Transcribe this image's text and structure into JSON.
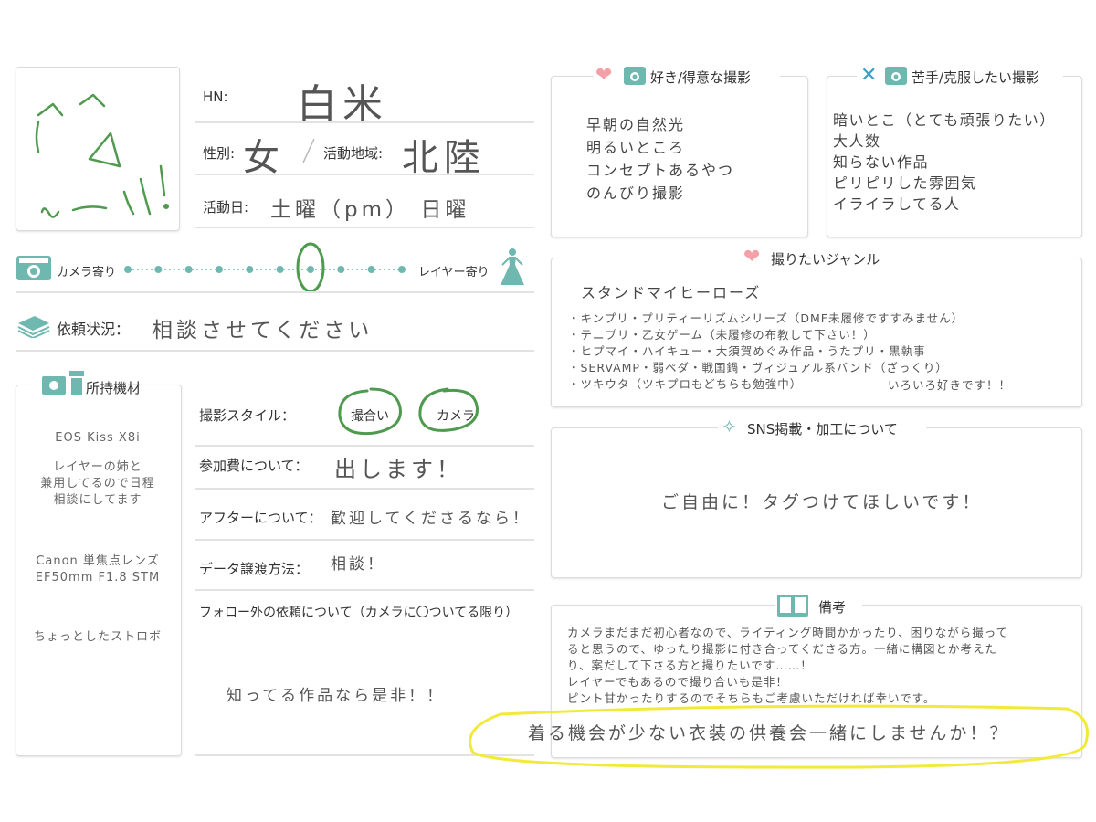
{
  "profile": {
    "hn_label": "HN:",
    "hn_value": "白米",
    "gender_label": "性別:",
    "gender_value": "女",
    "area_label": "活動地域:",
    "area_value": "北陸",
    "days_label": "活動日:",
    "days_value": "土曜（pm） 日曜",
    "avatar_scribble": "わーい！"
  },
  "scale": {
    "left_label": "カメラ寄り",
    "right_label": "レイヤー寄り",
    "dot_count": 10,
    "selected_index": 6
  },
  "request": {
    "label": "依頼状況：",
    "value": "相談させてください"
  },
  "gear": {
    "title": "所持機材",
    "items": [
      "EOS Kiss X8i",
      "レイヤーの姉と",
      "兼用してるので日程",
      "相談にしてます",
      "Canon 単焦点レンズ",
      "EF50mm F1.8 STM",
      "ちょっとしたストロボ"
    ]
  },
  "details": {
    "style_label": "撮影スタイル：",
    "style_options": [
      "撮合い",
      "カメラ"
    ],
    "fee_label": "参加費について：",
    "fee_value": "出します！",
    "after_label": "アフターについて：",
    "after_value": "歓迎してくださるなら！",
    "data_label": "データ譲渡方法：",
    "data_value": "相談！",
    "follow_label": "フォロー外の依頼について（カメラに〇ついてる限り）",
    "follow_value": "知ってる作品なら是非！！"
  },
  "likes": {
    "title": "好き/得意な撮影",
    "items": [
      "早朝の自然光",
      "明るいところ",
      "コンセプトあるやつ",
      "のんびり撮影"
    ]
  },
  "dislikes": {
    "title": "苦手/克服したい撮影",
    "items": [
      "暗いとこ（とても頑張りたい）",
      "大人数",
      "知らない作品",
      "ピリピリした雰囲気",
      "イライラしてる人"
    ]
  },
  "genres": {
    "title": "撮りたいジャンル",
    "headline": "スタンドマイヒーローズ",
    "items": [
      "・キンプリ・プリティーリズムシリーズ（DMF未履修ですすみません）",
      "・テニプリ・乙女ゲーム（未履修の布教して下さい！）",
      "・ヒプマイ・ハイキュー・大須賀めぐみ作品・うたプリ・黒執事",
      "・SERVAMP・弱ペダ・戦国鍋・ヴィジュアル系バンド（ざっくり）",
      "・ツキウタ（ツキプロもどちらも勉強中）"
    ],
    "note": "いろいろ好きです！！"
  },
  "sns": {
    "title": "SNS掲載・加工について",
    "value": "ご自由に！タグつけてほしいです！"
  },
  "remarks": {
    "title": "備考",
    "lines": [
      "カメラまだまだ初心者なので、ライティング時間かかったり、困りながら撮って",
      "ると思うので、ゆったり撮影に付き合ってくださる方。一緒に構図とか考えた",
      "り、案だして下さる方と撮りたいです……！",
      "レイヤーでもあるので撮り合いも是非！",
      "ピント甘かったりするのでそちらもご考慮いただければ幸いです。"
    ],
    "highlight": "着る機会が少ない衣装の供養会一緒にしませんか！？"
  },
  "colors": {
    "accent": "#6fb8b0",
    "heart": "#f4a0a8",
    "circle_marker": "#4f9a4f",
    "highlight_marker": "#f2ea3a"
  }
}
